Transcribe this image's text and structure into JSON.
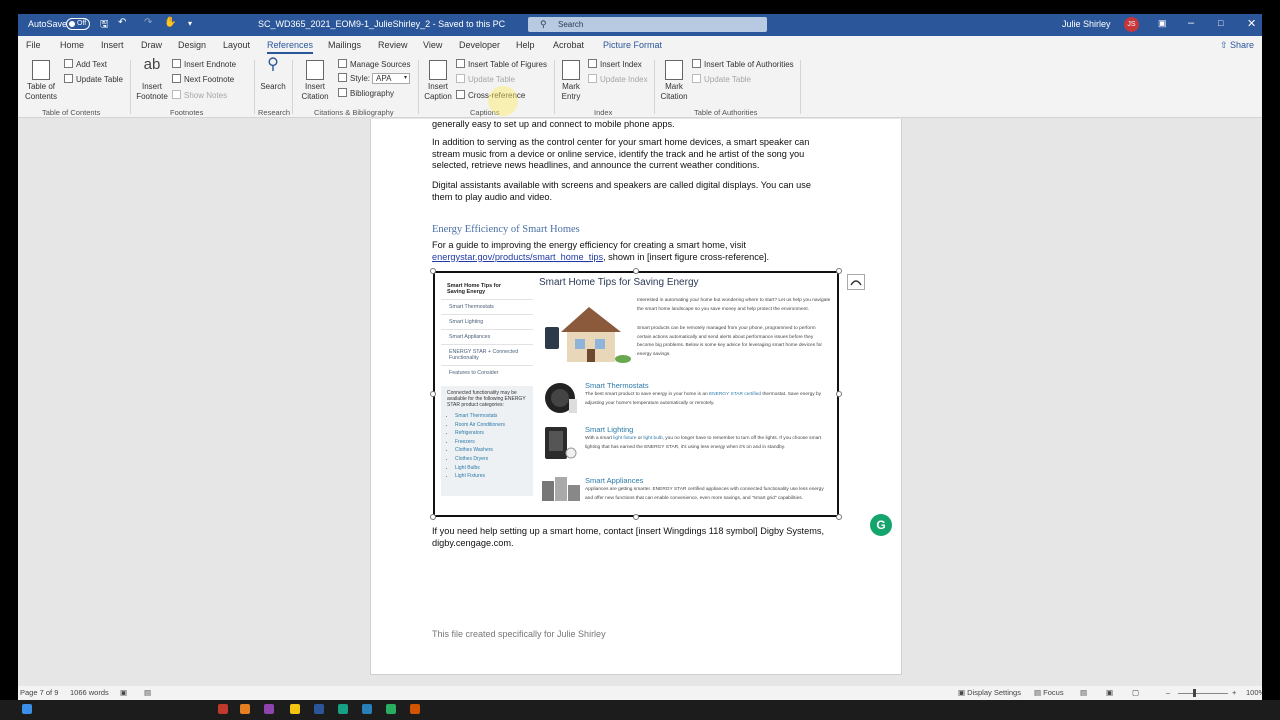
{
  "title_bar": {
    "autosave_label": "AutoSave",
    "autosave_state": "Off",
    "doc_title": "SC_WD365_2021_EOM9-1_JulieShirley_2  -  Saved to this PC",
    "search_placeholder": "Search",
    "user_name": "Julie Shirley",
    "user_initials": "JS"
  },
  "menu": {
    "tabs": [
      "File",
      "Home",
      "Insert",
      "Draw",
      "Design",
      "Layout",
      "References",
      "Mailings",
      "Review",
      "View",
      "Developer",
      "Help",
      "Acrobat",
      "Picture Format"
    ],
    "active_tab": "References",
    "share_label": "Share"
  },
  "ribbon": {
    "toc": {
      "big_label_1": "Table of",
      "big_label_2": "Contents",
      "add_text": "Add Text",
      "update_table": "Update Table",
      "group": "Table of Contents"
    },
    "footnotes": {
      "big_label_1": "Insert",
      "big_label_2": "Footnote",
      "insert_endnote": "Insert Endnote",
      "next_footnote": "Next Footnote",
      "show_notes": "Show Notes",
      "group": "Footnotes",
      "big_glyph": "ab"
    },
    "research": {
      "search": "Search",
      "group": "Research"
    },
    "citations": {
      "big_label_1": "Insert",
      "big_label_2": "Citation",
      "manage_sources": "Manage Sources",
      "style_label": "Style:",
      "style_value": "APA",
      "bibliography": "Bibliography",
      "group": "Citations & Bibliography"
    },
    "captions": {
      "big_label_1": "Insert",
      "big_label_2": "Caption",
      "insert_tof": "Insert Table of Figures",
      "update_table": "Update Table",
      "cross_reference": "Cross-reference",
      "group": "Captions"
    },
    "index": {
      "big_label_1": "Mark",
      "big_label_2": "Entry",
      "insert_index": "Insert Index",
      "update_index": "Update Index",
      "group": "Index"
    },
    "toa": {
      "big_label_1": "Mark",
      "big_label_2": "Citation",
      "insert_toa": "Insert Table of Authorities",
      "update_table": "Update Table",
      "group": "Table of Authorities"
    }
  },
  "document": {
    "para0": "generally easy to set up and connect to mobile phone apps.",
    "para1": "In addition to serving as the control center for your smart home devices, a smart speaker can stream music from a device or online service, identify the track and he artist of the song you selected, retrieve news headlines, and announce the current weather conditions.",
    "para2": "Digital assistants available with screens and speakers are called digital displays. You can use them to play audio and video.",
    "heading": "Energy Efficiency of Smart Homes",
    "para3_a": "For a guide to improving the energy efficiency for creating a smart home, visit",
    "para3_link": "energystar.gov/products/smart_home_tips",
    "para3_b": ", shown in [insert figure cross-reference].",
    "para4": "If you need help setting up a smart home, contact [insert Wingdings 118 symbol] Digby Systems, digby.cengage.com.",
    "footer_text": "This file created specifically for Julie Shirley"
  },
  "figure": {
    "sidebar_title": "Smart Home Tips for Saving Energy",
    "sidebar_items": [
      "Smart Thermostats",
      "Smart Lighting",
      "Smart Appliances",
      "ENERGY STAR + Connected Functionality",
      "Features to Consider"
    ],
    "box_text": "Connected functionality may be available for the following ENERGY STAR product categories:",
    "box_list": [
      "Smart Thermostats",
      "Room Air Conditioners",
      "Refrigerators",
      "Freezers",
      "Clothes Washers",
      "Clothes Dryers",
      "Light Bulbs",
      "Light Fixtures"
    ],
    "main_title": "Smart Home Tips for Saving Energy",
    "intro1": "Interested in automating your home but wondering where to start? Let us help you navigate the smart home landscape so you save money and help protect the environment.",
    "intro2": "Smart products can be remotely managed from your phone, programmed to perform certain actions automatically and send alerts about performance issues before they become big problems.  Below is some key advice for leveraging smart home devices for energy savings.",
    "h1": "Smart Thermostats",
    "t1a": "The best smart product to save energy in your home is an ",
    "t1link": "ENERGY STAR certified",
    "t1b": " thermostat.  Save energy by adjusting your home's temperature automatically or remotely.",
    "h2": "Smart Lighting",
    "t2a": "With a smart ",
    "t2link1": "light fixture",
    "t2mid": " or ",
    "t2link2": "light bulb",
    "t2b": ", you no longer have to remember to turn off the lights.  If you choose smart lighting that has earned the ENERGY STAR, it's using less energy when it's on and in standby.",
    "h3": "Smart Appliances",
    "t3": "Appliances are getting smarter. ENERGY STAR certified appliances with connected functionality use less energy and offer new functions that can enable convenience, even more savings, and \"smart grid\" capabilities."
  },
  "status_bar": {
    "page": "Page 7 of 9",
    "words": "1066 words",
    "display_settings": "Display Settings",
    "focus": "Focus",
    "zoom": "100%"
  },
  "colors": {
    "accent": "#2b579a",
    "grammarly": "#14a46c",
    "link": "#1f3aa7"
  }
}
